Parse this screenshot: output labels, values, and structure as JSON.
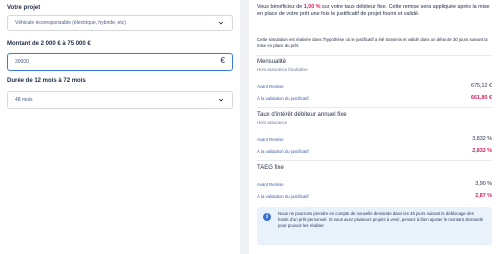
{
  "form": {
    "project_label": "Votre projet",
    "project_value": "Véhicule écoresponsable (électrique, hybride, etc)",
    "amount_label": "Montant de 2 000 € à 75 000 €",
    "amount_value": "30000",
    "currency_symbol": "€",
    "duration_label": "Durée de 12 mois à 72 mois",
    "duration_value": "48 mois"
  },
  "summary": {
    "intro_before": "Vous bénéficiez de ",
    "intro_highlight": "1,00 %",
    "intro_after": " sur votre taux débiteur fixe. Cette remise sera appliquée après la mise en place de votre prêt une fois le justificatif de projet fourni et validé.",
    "note": "Cette simulation est réalisée dans l'hypothèse où le justificatif a été transmis et validé dans un délai de 30 jours suivant la mise en place du prêt.",
    "sections": [
      {
        "title": "Mensualité",
        "subtitle": "Hors assurance facultative",
        "before_label": "Avant Remise",
        "before_value": "675,12 €",
        "after_label": "À la validation du justificatif",
        "after_value": "661,80 €"
      },
      {
        "title": "Taux d'intérêt débiteur annuel fixe",
        "subtitle": "Hors assurance",
        "before_label": "Avant Remise",
        "before_value": "3,832 %",
        "after_label": "À la validation du justificatif",
        "after_value": "2,832 %"
      },
      {
        "title": "TAEG fixe",
        "subtitle": "",
        "before_label": "Avant Remise",
        "before_value": "3,90 %",
        "after_label": "À la validation du justificatif",
        "after_value": "2,87 %"
      }
    ],
    "info_icon": "i",
    "info_text": "Nous ne pourrons prendre en compte de nouvelle demande dans les 45 jours suivant le déblocage des fonds d'un prêt personnel. Si vous avez plusieurs projets à venir, pensez à bien ajuster le montant demandé pour pouvoir les réaliser."
  },
  "colors": {
    "accent_pink": "#d81b60",
    "info_blue": "#3a6fd0",
    "active_border": "#3a7bd5"
  }
}
